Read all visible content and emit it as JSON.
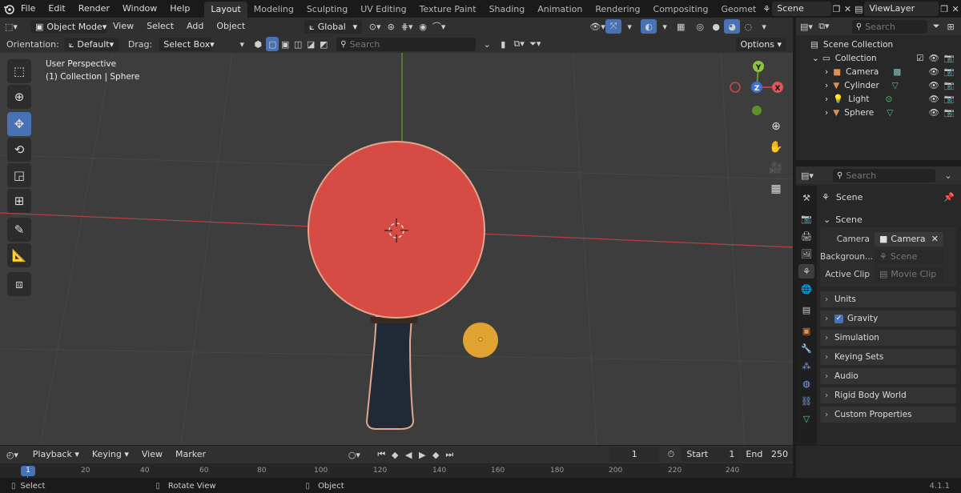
{
  "topbar": {
    "menu": [
      "File",
      "Edit",
      "Render",
      "Window",
      "Help"
    ],
    "workspaces": [
      "Layout",
      "Modeling",
      "Sculpting",
      "UV Editing",
      "Texture Paint",
      "Shading",
      "Animation",
      "Rendering",
      "Compositing",
      "Geomet"
    ],
    "scene": "Scene",
    "view_layer": "ViewLayer"
  },
  "viewport_header": {
    "mode": "Object Mode",
    "menu": [
      "View",
      "Select",
      "Add",
      "Object"
    ],
    "transform_orientation": "Global"
  },
  "tool_header": {
    "orientation_label": "Orientation:",
    "orientation_value": "Default",
    "drag_label": "Drag:",
    "drag_value": "Select Box",
    "search_placeholder": "Search",
    "options_label": "Options"
  },
  "viewport": {
    "perspective": "User Perspective",
    "context": "(1) Collection | Sphere",
    "gizmo": {
      "x": "X",
      "y": "Y",
      "z": "Z"
    }
  },
  "outliner": {
    "search_placeholder": "Search",
    "root": "Scene Collection",
    "collection": "Collection",
    "items": [
      "Camera",
      "Cylinder",
      "Light",
      "Sphere"
    ]
  },
  "properties": {
    "search_placeholder": "Search",
    "title": "Scene",
    "section": "Scene",
    "fields": [
      {
        "label": "Camera",
        "value": "Camera"
      },
      {
        "label": "Backgroun...",
        "value": "Scene"
      },
      {
        "label": "Active Clip",
        "value": "Movie Clip"
      }
    ],
    "subsections": [
      "Units",
      "Gravity",
      "Simulation",
      "Keying Sets",
      "Audio",
      "Rigid Body World",
      "Custom Properties"
    ]
  },
  "timeline": {
    "menu": [
      "Playback",
      "Keying",
      "View",
      "Marker"
    ],
    "current_frame": "1",
    "start_label": "Start",
    "start_value": "1",
    "end_label": "End",
    "end_value": "250",
    "ruler": [
      "1",
      "20",
      "40",
      "60",
      "80",
      "100",
      "120",
      "140",
      "160",
      "180",
      "200",
      "220",
      "240"
    ]
  },
  "statusbar": {
    "select": "Select",
    "rotate": "Rotate View",
    "object": "Object",
    "version": "4.1.1"
  },
  "colors": {
    "accent": "#4772b3",
    "paddle": "#d64b43",
    "ball": "#e0a332",
    "handle": "#1f2a36",
    "viewport_bg": "#3d3d3d",
    "x_axis": "#b84040",
    "y_axis": "#6a9a2a"
  }
}
